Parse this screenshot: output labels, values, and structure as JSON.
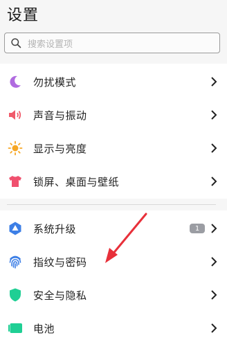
{
  "header": {
    "title": "设置"
  },
  "search": {
    "placeholder": "搜索设置项"
  },
  "sections": {
    "first": [
      {
        "label": "勿扰模式",
        "icon": "moon-icon",
        "color": "#b06be0"
      },
      {
        "label": "声音与振动",
        "icon": "speaker-icon",
        "color": "#f05a6a"
      },
      {
        "label": "显示与亮度",
        "icon": "sun-icon",
        "color": "#f6a623"
      },
      {
        "label": "锁屏、桌面与壁纸",
        "icon": "tshirt-icon",
        "color": "#f0506e"
      }
    ],
    "second": [
      {
        "label": "系统升级",
        "icon": "update-icon",
        "color": "#3d7fe6",
        "badge": "1"
      },
      {
        "label": "指纹与密码",
        "icon": "fingerprint-icon",
        "color": "#3d7fe6"
      },
      {
        "label": "安全与隐私",
        "icon": "shield-icon",
        "color": "#1fcf94"
      },
      {
        "label": "电池",
        "icon": "battery-icon",
        "color": "#1fcf94"
      }
    ]
  },
  "annotation": {
    "arrow_color": "#e8303a"
  }
}
